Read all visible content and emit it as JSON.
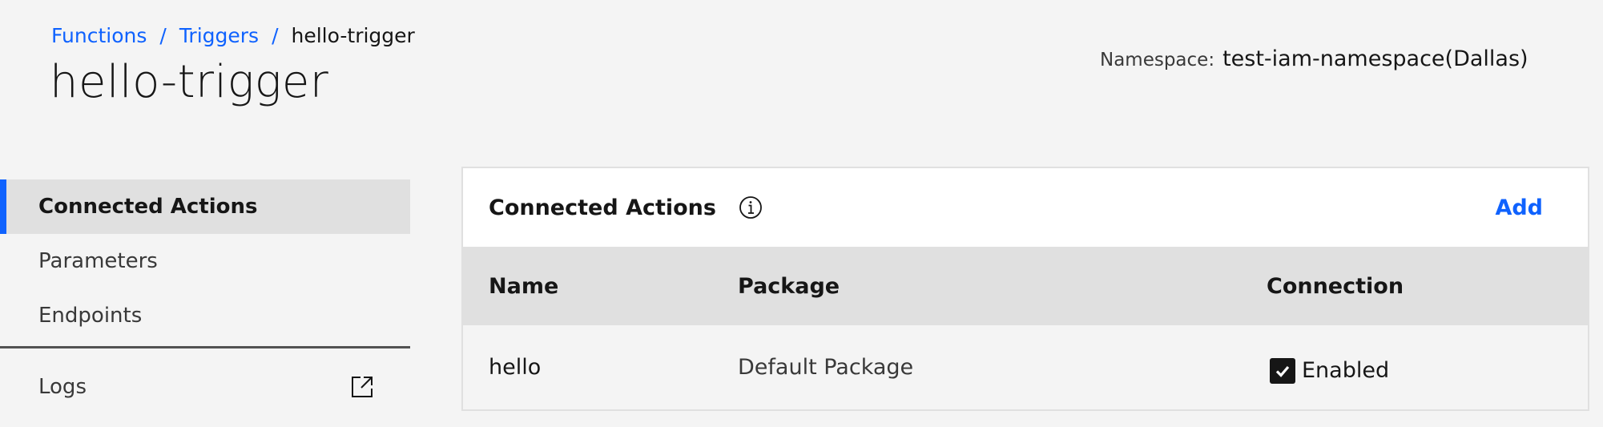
{
  "breadcrumb": {
    "items": [
      "Functions",
      "Triggers"
    ],
    "separator": "/",
    "current": "hello-trigger"
  },
  "page_title": "hello-trigger",
  "namespace": {
    "label": "Namespace:",
    "value": "test-iam-namespace(Dallas)"
  },
  "sidebar": {
    "items": [
      {
        "label": "Connected Actions",
        "active": true
      },
      {
        "label": "Parameters",
        "active": false
      },
      {
        "label": "Endpoints",
        "active": false
      }
    ],
    "logs_label": "Logs"
  },
  "panel": {
    "title": "Connected Actions",
    "add_label": "Add",
    "columns": [
      "Name",
      "Package",
      "Connection"
    ],
    "rows": [
      {
        "name": "hello",
        "package": "Default Package",
        "connection": "Enabled",
        "checked": true
      }
    ]
  },
  "colors": {
    "accent": "#0f62fe",
    "background": "#f4f4f4",
    "header_row": "#e0e0e0"
  }
}
